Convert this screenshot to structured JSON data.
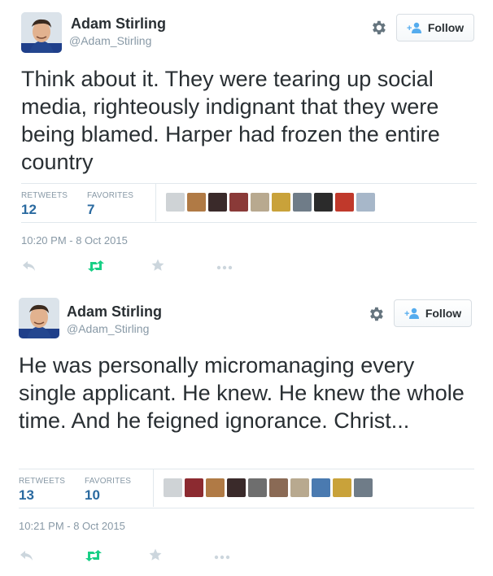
{
  "tweets": [
    {
      "author": {
        "name": "Adam Stirling",
        "handle": "@Adam_Stirling"
      },
      "follow_label": "Follow",
      "text": "Think about it. They were tearing up social media, righteously indignant that they were being blamed. Harper had frozen the entire country",
      "retweets_label": "RETWEETS",
      "retweets": "12",
      "favorites_label": "FAVORITES",
      "favorites": "7",
      "timestamp": "10:20 PM - 8 Oct 2015",
      "favoriter_avatar_colors": [
        "#cfd3d6",
        "#b07a45",
        "#3a2a2a",
        "#8a3a38",
        "#b8a98f",
        "#c9a23a",
        "#6f7c88",
        "#2b2b2b",
        "#c0392b",
        "#a7b7c9"
      ]
    },
    {
      "author": {
        "name": "Adam Stirling",
        "handle": "@Adam_Stirling"
      },
      "follow_label": "Follow",
      "text": "He was personally micromanaging every single applicant. He knew. He knew the whole time. And he feigned ignorance. Christ...",
      "retweets_label": "RETWEETS",
      "retweets": "13",
      "favorites_label": "FAVORITES",
      "favorites": "10",
      "timestamp": "10:21 PM - 8 Oct 2015",
      "favoriter_avatar_colors": [
        "#cfd3d6",
        "#8c2a30",
        "#b07a45",
        "#3a2a2a",
        "#6e6e6e",
        "#8a6a55",
        "#b8a98f",
        "#4a7ab0",
        "#c9a23a",
        "#6f7c88"
      ]
    }
  ],
  "colors": {
    "text": "#292f33",
    "muted": "#8899a6",
    "stat_value": "#2a6aa0",
    "retweet_green": "#19cf86",
    "icon_gray": "#ccd6dd"
  },
  "icons": [
    "gear-icon",
    "follow-person-icon",
    "reply-icon",
    "retweet-icon",
    "favorite-star-icon",
    "more-dots-icon"
  ]
}
